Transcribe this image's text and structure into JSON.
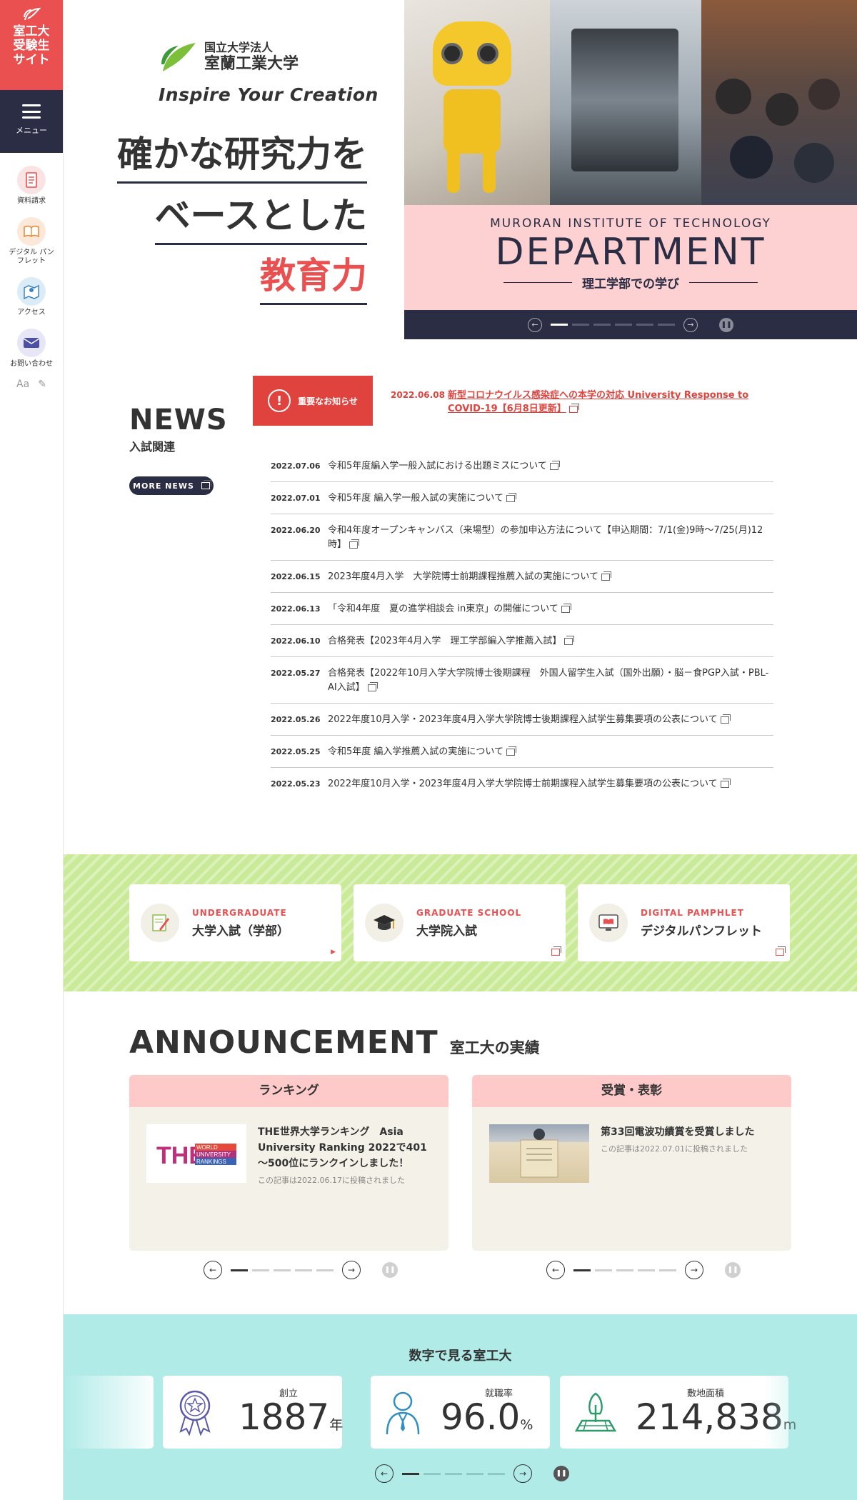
{
  "sidebar": {
    "brand": [
      "室工大",
      "受験生",
      "サイト"
    ],
    "menu_label": "メニュー",
    "items": [
      {
        "label": "資料請求",
        "icon": "document-icon",
        "color": "#fbe3e3"
      },
      {
        "label": "デジタル パンフレット",
        "icon": "book-icon",
        "color": "#fbe8d8"
      },
      {
        "label": "アクセス",
        "icon": "map-icon",
        "color": "#dcecf7"
      },
      {
        "label": "お問い合わせ",
        "icon": "mail-icon",
        "color": "#e6e6f6"
      }
    ],
    "font_size_label": "Aa"
  },
  "hero": {
    "logo_sub": "国立大学法人",
    "logo_main": "室蘭工業大学",
    "tagline": "Inspire Your Creation",
    "catch": [
      "確かな研究力を",
      "ベースとした",
      "教育力"
    ],
    "slider": {
      "en": "MURORAN  INSTITUTE OF TECHNOLOGY",
      "title": "DEPARTMENT",
      "jp": "理工学部での学び",
      "slide_count": 6,
      "active_index": 0
    }
  },
  "news": {
    "title": "NEWS",
    "subtitle": "入試関連",
    "more_label": "MORE NEWS",
    "important": {
      "badge": "重要なお知らせ",
      "date": "2022.06.08",
      "text": "新型コロナウイルス感染症への本学の対応 University Response to COVID-19【6月8日更新】"
    },
    "items": [
      {
        "date": "2022.07.06",
        "text": "令和5年度編入学一般入試における出題ミスについて"
      },
      {
        "date": "2022.07.01",
        "text": "令和5年度 編入学一般入試の実施について"
      },
      {
        "date": "2022.06.20",
        "text": "令和4年度オープンキャンパス（来場型）の参加申込方法について【申込期間：7/1(金)9時～7/25(月)12時】"
      },
      {
        "date": "2022.06.15",
        "text": "2023年度4月入学　大学院博士前期課程推薦入試の実施について"
      },
      {
        "date": "2022.06.13",
        "text": "「令和4年度　夏の進学相談会 in東京」の開催について"
      },
      {
        "date": "2022.06.10",
        "text": "合格発表【2023年4月入学　理工学部編入学推薦入試】"
      },
      {
        "date": "2022.05.27",
        "text": "合格発表【2022年10月入学大学院博士後期課程　外国人留学生入試（国外出願）・脳－食PGP入試・PBL-AI入試】"
      },
      {
        "date": "2022.05.26",
        "text": "2022年度10月入学・2023年度4月入学大学院博士後期課程入試学生募集要項の公表について"
      },
      {
        "date": "2022.05.25",
        "text": "令和5年度 編入学推薦入試の実施について"
      },
      {
        "date": "2022.05.23",
        "text": "2022年度10月入学・2023年度4月入学大学院博士前期課程入試学生募集要項の公表について"
      }
    ]
  },
  "categories": [
    {
      "en": "UNDERGRADUATE",
      "jp": "大学入試（学部）",
      "icon": "pencil-note-icon"
    },
    {
      "en": "GRADUATE SCHOOL",
      "jp": "大学院入試",
      "icon": "graduation-cap-icon"
    },
    {
      "en": "DIGITAL PAMPHLET",
      "jp": "デジタルパンフレット",
      "icon": "monitor-book-icon"
    }
  ],
  "announcement": {
    "title_en": "ANNOUNCEMENT",
    "title_jp": "室工大の実績",
    "boxes": [
      {
        "head": "ランキング",
        "item_title": "THE世界大学ランキング　Asia University Ranking 2022で401～500位にランクインしました！",
        "item_meta": "この記事は2022.06.17に投稿されました",
        "thumb_logo": "THE",
        "thumb_lines": [
          "WORLD",
          "UNIVERSITY",
          "RANKINGS"
        ],
        "slide_count": 5,
        "active_index": 0
      },
      {
        "head": "受賞・表彰",
        "item_title": "第33回電波功績賞を受賞しました",
        "item_meta": "この記事は2022.07.01に投稿されました",
        "slide_count": 5,
        "active_index": 0
      }
    ]
  },
  "numbers": {
    "title": "数字で見る室工大",
    "items": [
      {
        "label": "創立",
        "value": "1887",
        "unit": "年",
        "icon": "award-medal-icon"
      },
      {
        "label": "就職率",
        "value": "96.0",
        "unit": "%",
        "icon": "businessman-icon"
      },
      {
        "label": "敷地面積",
        "value": "214,838",
        "unit": "m",
        "icon": "tree-field-icon"
      }
    ],
    "slide_count": 5,
    "active_index": 0
  },
  "colors": {
    "accent": "#e9504f",
    "navy": "#2b2d44",
    "pink": "#fdd1d1",
    "green_band": "#c9ea96",
    "teal": "#b0ebe8"
  }
}
